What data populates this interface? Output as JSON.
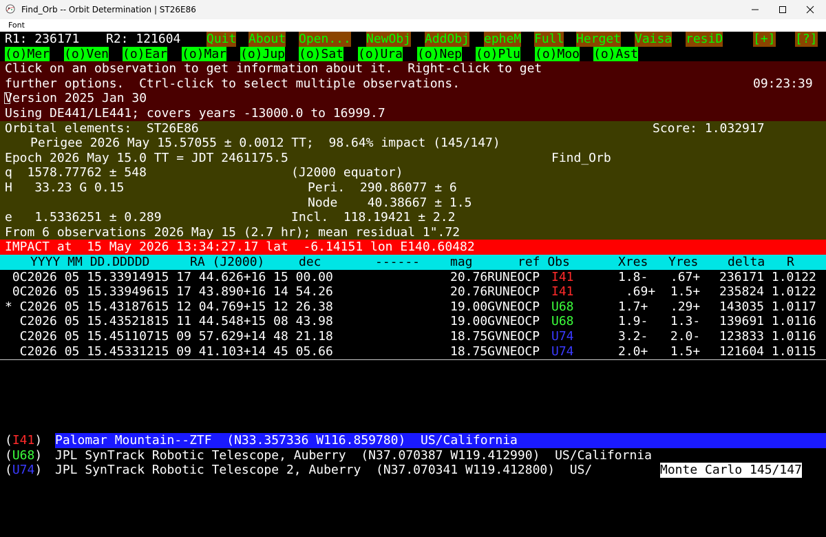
{
  "window": {
    "title": "Find_Orb -- Orbit Determination | ST26E86",
    "menu_font": "Font",
    "minimize_icon": "minimize-icon",
    "maximize_icon": "maximize-icon",
    "close_icon": "close-icon"
  },
  "toolbar": {
    "r1": "R1: 236171",
    "r2": "R2: 121604",
    "buttons": [
      "Quit",
      "About",
      "Open...",
      "NewObj",
      "AddObj",
      "epheM",
      "Full",
      "Herget",
      "Vaisa",
      "resiD"
    ],
    "plus": "[+]",
    "help": "[?]"
  },
  "planets": [
    "(o)Mer",
    "(o)Ven",
    "(o)Ear",
    "(o)Mar",
    "(o)Jup",
    "(o)Sat",
    "(o)Ura",
    "(o)Nep",
    "(o)Plu",
    "(o)Moo",
    "(o)Ast"
  ],
  "info": {
    "line1": "Click on an observation to get information about it.  Right-click to get",
    "line2": "further options.  Ctrl-click to select multiple observations.",
    "time": "09:23:39",
    "version_rest": "ersion 2025 Jan 30",
    "version_first": "V",
    "ephem": "Using DE441/LE441; covers years -13000.0 to 16999.7"
  },
  "elements": {
    "header": "Orbital elements:  ST26E86",
    "score": "Score: 1.032917",
    "perigee": "Perigee 2026 May 15.57055 ± 0.0012 TT;  98.64% impact (145/147)",
    "epoch": "Epoch 2026 May 15.0 TT = JDT 2461175.5",
    "find_orb": "Find_Orb",
    "q": "q  1578.77762 ± 548",
    "frame": "(J2000 equator)",
    "h": "H   33.23 G 0.15",
    "peri": "Peri.  290.86077 ± 6",
    "node": "Node    40.38667 ± 1.5",
    "e": "e   1.5336251 ± 0.289",
    "incl": "Incl.  118.19421 ± 2.2",
    "from": "From 6 observations 2026 May 15 (2.7 hr); mean residual 1\".72"
  },
  "impact": "IMPACT at  15 May 2026 13:34:27.17 lat  -6.14151 lon E140.60482",
  "obs_header": {
    "date": "YYYY MM DD.DDDDD",
    "ra": "RA (J2000)",
    "dec": "dec",
    "dash": "------",
    "mag": "mag",
    "refobs": "ref Obs",
    "xres": "Xres",
    "yres": "Yres",
    "delta": "delta",
    "r": "R"
  },
  "observations": [
    {
      "main": " 0C2026 05 15.33914915 17 44.626+16 15 00.00",
      "mag": "20.76RUNEOCP",
      "code": "I41",
      "resid": "1.8-   .67+",
      "delta": "236171 1.0122"
    },
    {
      "main": " 0C2026 05 15.33949615 17 43.890+16 14 54.26",
      "mag": "20.76RUNEOCP",
      "code": "I41",
      "resid": " .69+  1.5+",
      "delta": "235824 1.0122"
    },
    {
      "main": "* C2026 05 15.43187615 12 04.769+15 12 26.38",
      "mag": "19.00GVNEOCP",
      "code": "U68",
      "resid": "1.7+   .29+",
      "delta": "143035 1.0117"
    },
    {
      "main": "  C2026 05 15.43521815 11 44.548+15 08 43.98",
      "mag": "19.00GVNEOCP",
      "code": "U68",
      "resid": "1.9-   1.3-",
      "delta": "139691 1.0116"
    },
    {
      "main": "  C2026 05 15.45110715 09 57.629+14 48 21.18",
      "mag": "18.75GVNEOCP",
      "code": "U74",
      "resid": "3.2-   2.0-",
      "delta": "123833 1.0116"
    },
    {
      "main": "  C2026 05 15.45331215 09 41.103+14 45 05.66",
      "mag": "18.75GVNEOCP",
      "code": "U74",
      "resid": "2.0+   1.5+",
      "delta": "121604 1.0115"
    }
  ],
  "sites": [
    {
      "code": "I41",
      "text": "Palomar Mountain--ZTF  (N33.357336 W116.859780)  US/California"
    },
    {
      "code": "U68",
      "text": "JPL SynTrack Robotic Telescope, Auberry  (N37.070387 W119.412990)  US/California"
    },
    {
      "code": "U74",
      "text": "JPL SynTrack Robotic Telescope 2, Auberry  (N37.070341 W119.412800)  US/"
    }
  ],
  "monte_carlo": "Monte Carlo 145/147",
  "colors": {
    "info_bg": "#4a0000",
    "elements_bg": "#3d3d00",
    "impact_bg": "#ff0000",
    "header_bg": "#00e5e5",
    "cmd_bg": "#8b4500",
    "planet_bg": "#00ff00",
    "site_sel_bg": "#1a1aff"
  }
}
